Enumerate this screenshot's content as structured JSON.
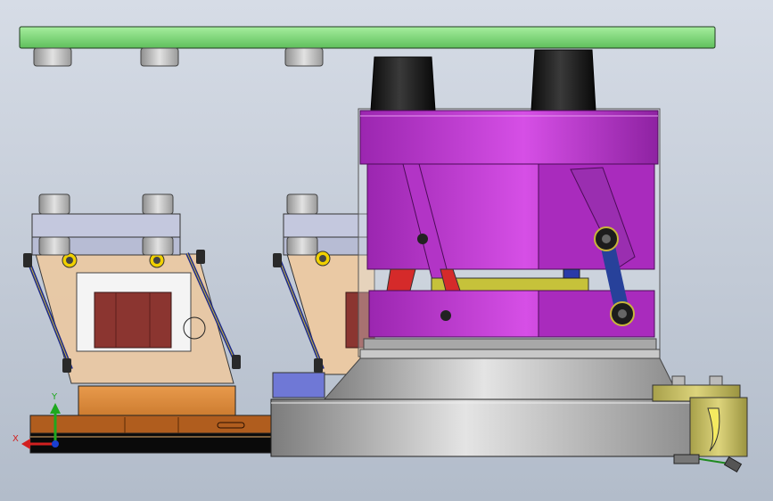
{
  "view": {
    "triad": {
      "x_label": "X",
      "y_label": "Y"
    },
    "colors": {
      "background_top": "#d6dce6",
      "background_bottom": "#b2bcca",
      "top_plate": "#7ed77a",
      "cylinder_head": "#c33fd6",
      "link_arm": "#27419a",
      "base_metal": "#b9b9b9",
      "jaw_block": "#eac9a4",
      "fixture_base": "#d88c3a"
    }
  }
}
